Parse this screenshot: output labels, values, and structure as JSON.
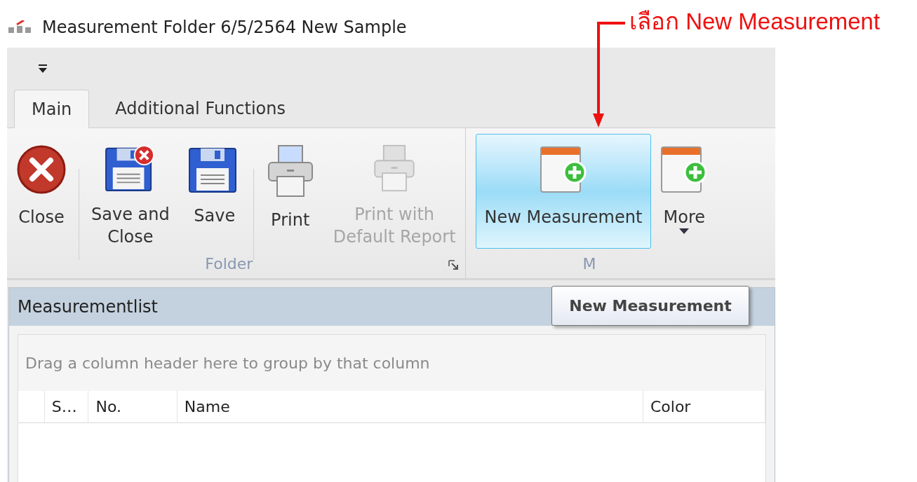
{
  "window": {
    "title": "Measurement Folder 6/5/2564 New Sample"
  },
  "tabs": [
    {
      "label": "Main",
      "selected": true
    },
    {
      "label": "Additional Functions",
      "selected": false
    }
  ],
  "ribbon": {
    "groups": [
      {
        "label": "Folder",
        "launcher": true,
        "items": [
          {
            "kind": "close",
            "label": "Close",
            "disabled": false,
            "highlighted": false
          },
          {
            "kind": "separator"
          },
          {
            "kind": "save-close",
            "label": "Save and\nClose",
            "disabled": false,
            "highlighted": false
          },
          {
            "kind": "save",
            "label": "Save",
            "disabled": false,
            "highlighted": false
          },
          {
            "kind": "separator"
          },
          {
            "kind": "print",
            "label": "Print",
            "disabled": false,
            "highlighted": false
          },
          {
            "kind": "print",
            "label": "Print with\nDefault Report",
            "disabled": true,
            "highlighted": false
          }
        ]
      },
      {
        "label": "M",
        "items": [
          {
            "kind": "new",
            "label": "New Measurement",
            "disabled": false,
            "highlighted": true
          },
          {
            "kind": "new",
            "label": "More",
            "disabled": false,
            "highlighted": false,
            "dropdown": true
          }
        ]
      }
    ]
  },
  "tooltip": {
    "text": "New Measurement"
  },
  "panel": {
    "title": "Measurementlist",
    "group_hint": "Drag a column header here to group by that column",
    "columns": [
      "S…",
      "No.",
      "Name",
      "Color"
    ]
  },
  "annotation": {
    "text": "เลือก New Measurement"
  }
}
